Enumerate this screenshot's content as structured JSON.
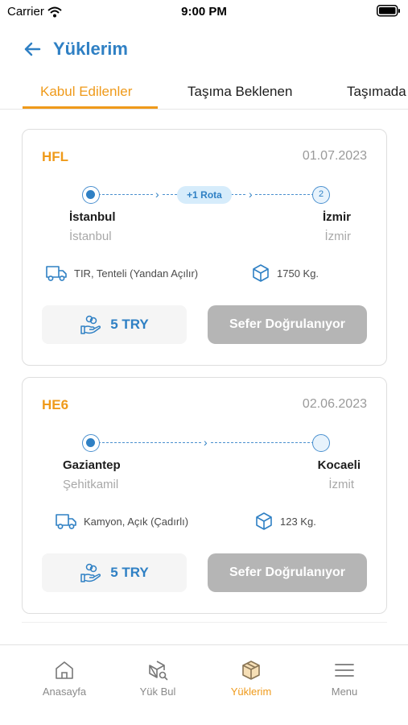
{
  "status_bar": {
    "carrier": "Carrier",
    "time": "9:00 PM"
  },
  "header": {
    "title": "Yüklerim"
  },
  "tabs": [
    {
      "label": "Kabul Edilenler",
      "active": true
    },
    {
      "label": "Taşıma Beklenen",
      "active": false
    },
    {
      "label": "Taşımada",
      "active": false
    }
  ],
  "loads": [
    {
      "code": "HFL",
      "date": "01.07.2023",
      "route_badge": "+1 Rota",
      "end_marker": "2",
      "origin_city": "İstanbul",
      "origin_district": "İstanbul",
      "destination_city": "İzmir",
      "destination_district": "İzmir",
      "vehicle": "TIR, Tenteli (Yandan Açılır)",
      "weight": "1750 Kg.",
      "price": "5 TRY",
      "status_button": "Sefer Doğrulanıyor"
    },
    {
      "code": "HE6",
      "date": "02.06.2023",
      "route_badge": "",
      "end_marker": "",
      "origin_city": "Gaziantep",
      "origin_district": "Şehitkamil",
      "destination_city": "Kocaeli",
      "destination_district": "İzmit",
      "vehicle": "Kamyon, Açık (Çadırlı)",
      "weight": "123 Kg.",
      "price": "5 TRY",
      "status_button": "Sefer Doğrulanıyor"
    }
  ],
  "bottom_nav": [
    {
      "label": "Anasayfa",
      "icon": "home-icon",
      "active": false
    },
    {
      "label": "Yük Bul",
      "icon": "box-search-icon",
      "active": false
    },
    {
      "label": "Yüklerim",
      "icon": "box-icon",
      "active": true
    },
    {
      "label": "Menu",
      "icon": "menu-icon",
      "active": false
    }
  ],
  "colors": {
    "accent_blue": "#2f80c4",
    "accent_orange": "#ef9a1a",
    "disabled_gray": "#b5b5b5"
  }
}
